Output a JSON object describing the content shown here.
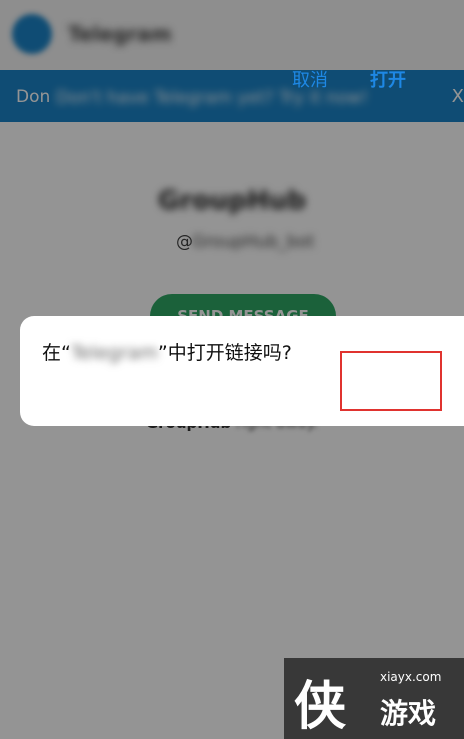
{
  "header": {
    "app_name": "Telegram"
  },
  "banner": {
    "prefix": "Don",
    "text": "Don't have Telegram yet? Try it now!",
    "close_glyph": "X"
  },
  "group": {
    "name": "GroupHub",
    "handle_prefix": "@",
    "handle": "GroupHub_bot"
  },
  "send_button": {
    "label": "SEND MESSAGE"
  },
  "subtext": {
    "bold": "GroupHub",
    "rest": " right away."
  },
  "dialog": {
    "message_prefix": "在“",
    "message_blurred": "Telegram",
    "message_suffix": "”中打开链接吗?",
    "cancel_label": "取消",
    "open_label": "打开"
  },
  "watermark": {
    "glyph": "侠",
    "url": "xiayx.com",
    "name": "游戏"
  },
  "colors": {
    "accent": "#1b84c8",
    "button_green": "#2fa764",
    "dialog_link": "#1e88e5",
    "highlight": "#e0332f"
  }
}
